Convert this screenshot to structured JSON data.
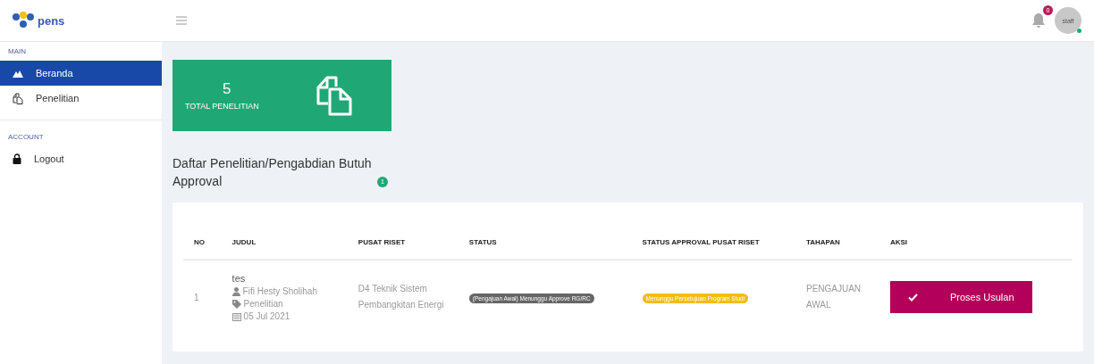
{
  "logo": {
    "text": "pens"
  },
  "topbar": {
    "notification_count": "0",
    "avatar_label": "staff",
    "online": true
  },
  "sidebar": {
    "sections": [
      {
        "title": "MAIN",
        "items": [
          {
            "label": "Beranda",
            "kind": "home",
            "selected": true
          },
          {
            "label": "Penelitian",
            "kind": "research",
            "selected": false
          }
        ]
      },
      {
        "title": "ACCOUNT",
        "items": [
          {
            "label": "Logout",
            "kind": "logout",
            "selected": false
          }
        ]
      }
    ]
  },
  "stat_card": {
    "value": "5",
    "label": "TOTAL PENELITIAN"
  },
  "heading": {
    "text": "Daftar Penelitian/Pengabdian Butuh Approval",
    "count": "1"
  },
  "table": {
    "columns": [
      "NO",
      "JUDUL",
      "PUSAT RISET",
      "STATUS",
      "STATUS APPROVAL PUSAT RISET",
      "TAHAPAN",
      "AKSI"
    ],
    "rows": [
      {
        "no": "1",
        "title": "tes",
        "author": "Fifi Hesty Sholihah",
        "category": "Penelitian",
        "date": "05 Jul 2021",
        "pusat_riset": "D4 Teknik Sistem Pembangkitan Energi",
        "status": "(Pengajuan Awal) Menunggu Approve RG/RC",
        "approval_status": "Menunggu Persetujuan Program Studi",
        "tahapan": "PENGAJUAN AWAL",
        "action": "Proses Usulan"
      }
    ]
  }
}
